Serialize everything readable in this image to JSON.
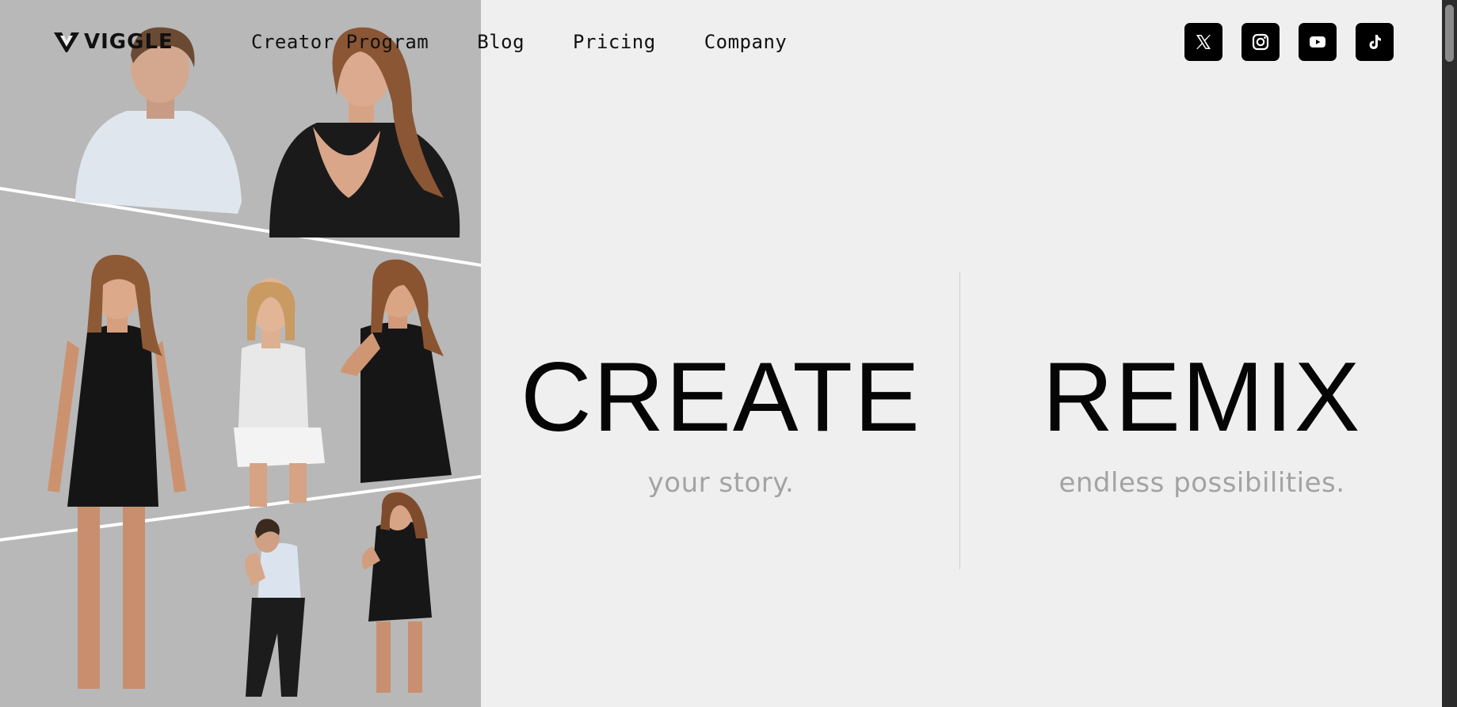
{
  "brand": {
    "name": "VIGGLE"
  },
  "nav": {
    "links": [
      {
        "label": "Creator Program"
      },
      {
        "label": "Blog"
      },
      {
        "label": "Pricing"
      },
      {
        "label": "Company"
      }
    ]
  },
  "socials": [
    {
      "name": "x",
      "icon": "x-icon"
    },
    {
      "name": "instagram",
      "icon": "instagram-icon"
    },
    {
      "name": "youtube",
      "icon": "youtube-icon"
    },
    {
      "name": "tiktok",
      "icon": "tiktok-icon"
    }
  ],
  "hero": {
    "create": {
      "heading": "CREATE",
      "sub": "your story."
    },
    "remix": {
      "heading": "REMIX",
      "sub": "endless possibilities."
    }
  },
  "colors": {
    "background": "#efefef",
    "collage_bg": "#b5b5b5",
    "heading": "#050505",
    "subheading": "#a3a3a3",
    "button_bg": "#000000"
  }
}
